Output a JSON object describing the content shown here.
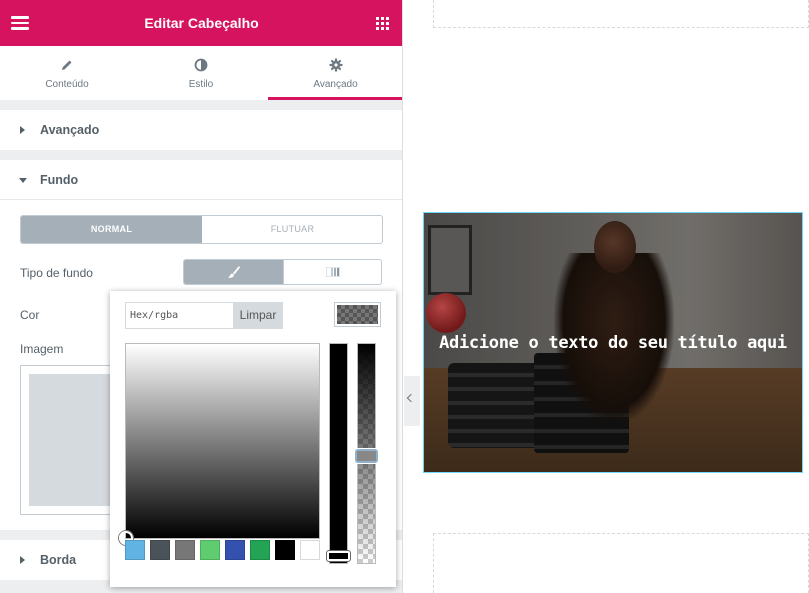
{
  "header": {
    "title": "Editar Cabeçalho"
  },
  "tabs": [
    {
      "label": "Conteúdo",
      "icon": "pencil-icon"
    },
    {
      "label": "Estilo",
      "icon": "contrast-icon"
    },
    {
      "label": "Avançado",
      "icon": "gear-icon",
      "active": true
    }
  ],
  "sections": {
    "advanced": "Avançado",
    "background": "Fundo",
    "border": "Borda"
  },
  "background": {
    "state_toggle": [
      "NORMAL",
      "FLUTUAR"
    ],
    "type_label": "Tipo de fundo",
    "type_options": [
      "paint-brush-icon",
      "gradient-icon"
    ],
    "color_label": "Cor",
    "image_label": "Imagem"
  },
  "picker": {
    "hex_placeholder": "Hex/rgba",
    "clear_label": "Limpar",
    "swatches": [
      "#61b3e4",
      "#4b535a",
      "#777777",
      "#5fcc6f",
      "#3451b0",
      "#23a455",
      "#000000",
      "#ffffff"
    ],
    "alpha_level": 0.5
  },
  "canvas": {
    "headline": "Adicione o texto do seu título aqui"
  },
  "colors": {
    "brand": "#d5135e",
    "panel_bg": "#eceeef",
    "toggle_active": "#a4afb7"
  }
}
